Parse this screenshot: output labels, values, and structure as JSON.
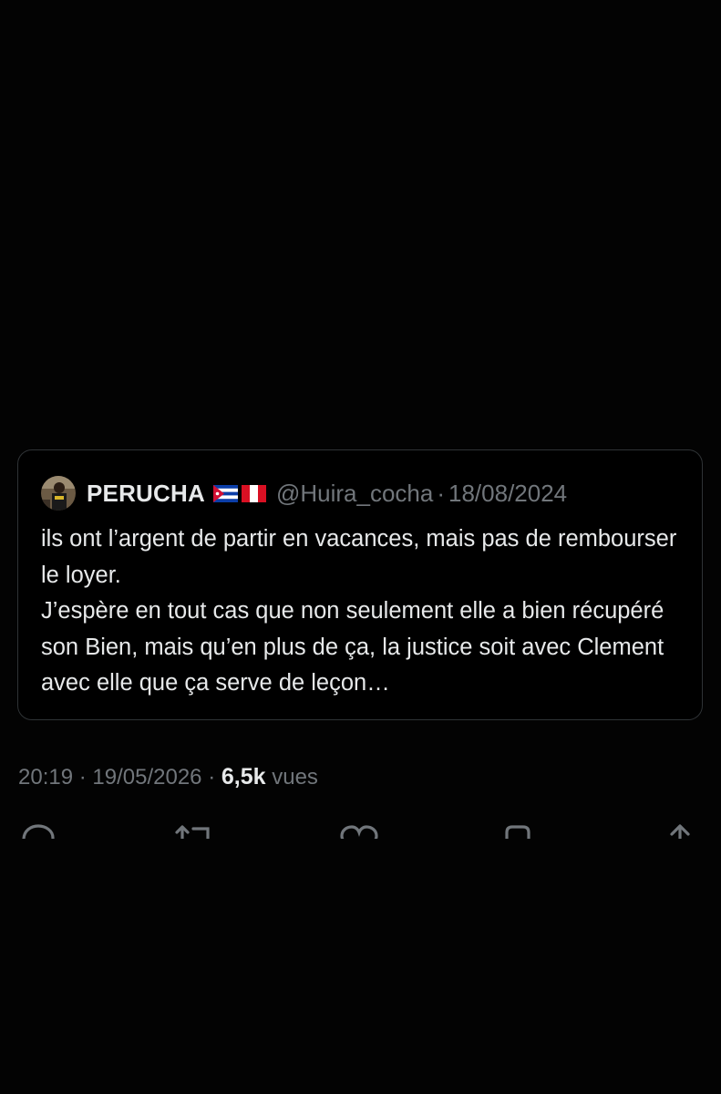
{
  "quoted_tweet": {
    "display_name": "PERUCHA",
    "flags": [
      "cuba-flag",
      "peru-flag"
    ],
    "handle": "@Huira_cocha",
    "separator": "·",
    "date": "18/08/2024",
    "text_lines": [
      "ils ont l’argent de partir en vacances, mais pas de rembourser le loyer.",
      "J’espère en tout cas que non seulement elle a bien récupéré son Bien, mais qu’en plus de ça, la justice soit avec Clement avec elle que ça serve de leçon…"
    ]
  },
  "tweet_meta": {
    "time": "20:19",
    "separator": "·",
    "date": "19/05/2026",
    "views_count": "6,5k",
    "views_label": "vues"
  },
  "actions": [
    {
      "name": "reply-icon"
    },
    {
      "name": "retweet-icon"
    },
    {
      "name": "like-icon"
    },
    {
      "name": "bookmark-icon"
    },
    {
      "name": "share-icon"
    }
  ],
  "colors": {
    "background": "#030303",
    "text": "#e7e9ea",
    "muted": "#71767b",
    "border": "#2f3336",
    "cuba_blue": "#0b3ea8",
    "cuba_red": "#d21034",
    "peru_red": "#d91023"
  }
}
